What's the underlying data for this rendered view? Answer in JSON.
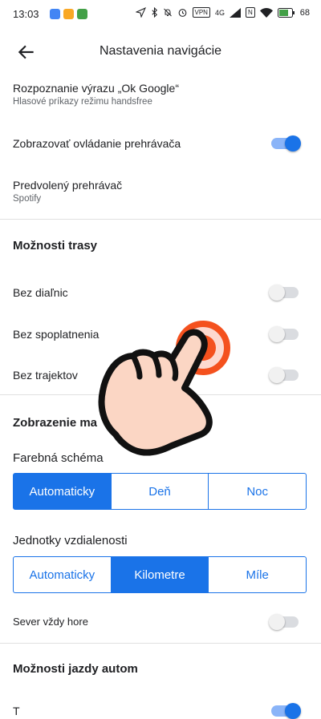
{
  "status_bar": {
    "time": "13:03",
    "battery": "68",
    "vpn": "VPN",
    "network": "4G",
    "sim": "N"
  },
  "appbar": {
    "title": "Nastavenia navigácie"
  },
  "items": {
    "ok_google": {
      "label": "Rozpoznanie výrazu „Ok Google“",
      "sub": "Hlasové príkazy režimu handsfree"
    },
    "player_controls": {
      "label": "Zobrazovať ovládanie prehrávača",
      "on": true
    },
    "default_player": {
      "label": "Predvolený prehrávač",
      "sub": "Spotify"
    }
  },
  "route_options": {
    "header": "Možnosti trasy",
    "avoid_highways": {
      "label": "Bez diaľnic",
      "on": false
    },
    "avoid_tolls": {
      "label": "Bez spoplatnenia",
      "on": false
    },
    "avoid_ferries": {
      "label": "Bez trajektov",
      "on": false
    }
  },
  "map_display": {
    "header": "Zobrazenie ma",
    "color_scheme": {
      "label": "Farebná schéma",
      "options": [
        "Automaticky",
        "Deň",
        "Noc"
      ],
      "selected": 0
    },
    "units": {
      "label": "Jednotky vzdialenosti",
      "options": [
        "Automaticky",
        "Kilometre",
        "Míle"
      ],
      "selected": 1
    },
    "north_up": {
      "label": "Sever vždy hore",
      "on": false
    }
  },
  "driving": {
    "header": "Možnosti jazdy autom",
    "cut_label": "T"
  },
  "colors": {
    "accent": "#1a73e8",
    "tap_ring": "#f4511e"
  }
}
